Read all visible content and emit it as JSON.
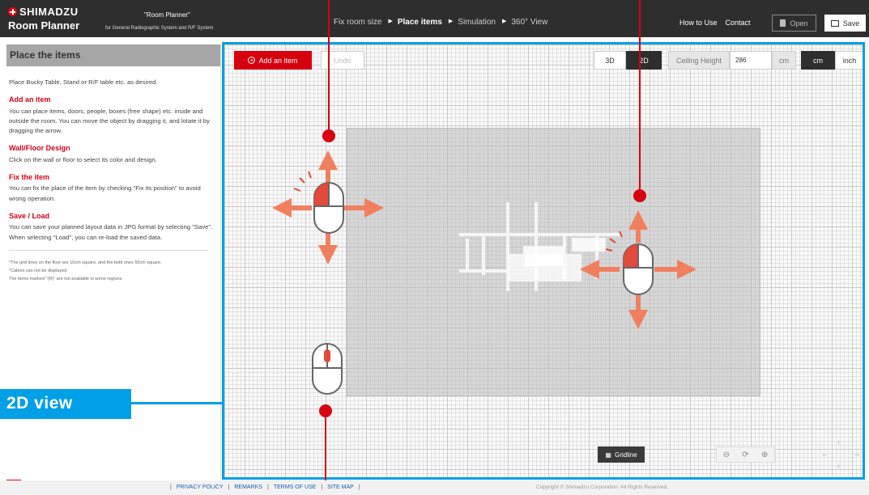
{
  "header": {
    "brand": "SHIMADZU",
    "app_name": "Room Planner",
    "app_title": "\"Room Planner\"",
    "app_subtitle": "for General Radiographic System and R/F System",
    "steps": [
      {
        "label": "Fix room size",
        "active": false
      },
      {
        "label": "Place items",
        "active": true
      },
      {
        "label": "Simulation",
        "active": false
      },
      {
        "label": "360° View",
        "active": false
      }
    ],
    "how_to_use": "How to Use",
    "contact": "Contact",
    "open_label": "Open",
    "save_label": "Save"
  },
  "panel": {
    "title": "Place the items",
    "intro": "Place Bucky Table, Stand or R/F table etc. as desired.",
    "sections": [
      {
        "title": "Add an item",
        "text": "You can place items, doors, people, boxes (free shape) etc. inside and outside the room. You can move the object by dragging it, and lotate it by dragging the arrow."
      },
      {
        "title": "Wall/Floor Design",
        "text": "Click on the wall or floor to select its color and design."
      },
      {
        "title": "Fix the item",
        "text": "You can fix the place of the item by checking \"Fix its position\" to avoid wrong operation."
      },
      {
        "title": "Save / Load",
        "text": "You can save your planned layout data in JPG format by selecting \"Save\". When selecting \"Load\", you can re-load the saved data."
      }
    ],
    "notes": [
      "*The grid lines on the floor are 10cm square, and the bold ones 50cm square.",
      "*Cables can not be displayed.",
      "The items marked \"(R)\" are not available in some regions."
    ]
  },
  "toolbar": {
    "add_item": "Add an item",
    "undo": "Undo",
    "view_3d": "3D",
    "view_2d": "2D",
    "ceiling_label": "Ceiling Height",
    "ceiling_value": "286",
    "ceiling_unit": "cm",
    "unit_cm": "cm",
    "unit_inch": "inch",
    "gridline": "Gridline"
  },
  "annotation": {
    "badge": "2D view",
    "accent": "#00a0e9",
    "marker_color": "#d7000f",
    "arrow_color": "#f07f5f"
  },
  "footer": {
    "links": [
      "PRIVACY POLICY",
      "REMARKS",
      "TERMS OF USE",
      "SITE MAP"
    ],
    "copyright": "Copyright © Shimadzu Corporation. All Rights Reserved."
  }
}
